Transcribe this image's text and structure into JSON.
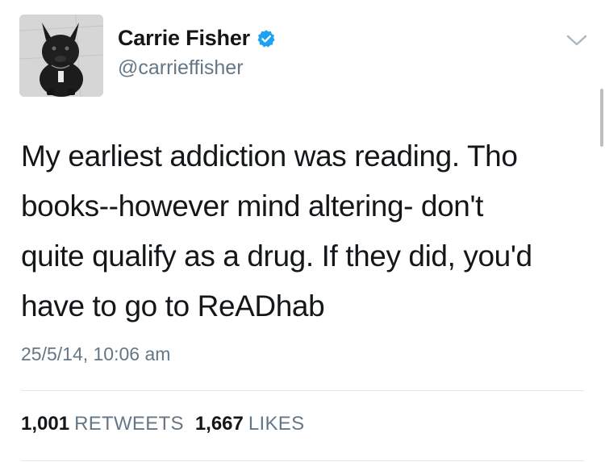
{
  "author": {
    "display_name": "Carrie Fisher",
    "handle": "@carrieffisher",
    "verified": true,
    "avatar": "french-bulldog-photo"
  },
  "tweet": {
    "lines": [
      "My earliest addiction was reading. Tho",
      "books--however mind altering- don't",
      "quite qualify as a drug. If they did, you'd",
      "have to go to ReADhab"
    ],
    "timestamp": "25/5/14, 10:06 am"
  },
  "stats": {
    "retweets_count": "1,001",
    "retweets_label": "RETWEETS",
    "likes_count": "1,667",
    "likes_label": "LIKES"
  },
  "icons": {
    "verified": "verified-badge-icon",
    "menu": "chevron-down-icon"
  },
  "colors": {
    "verified_blue": "#1da1f2",
    "secondary_text": "#657786",
    "primary_text": "#14171a"
  }
}
